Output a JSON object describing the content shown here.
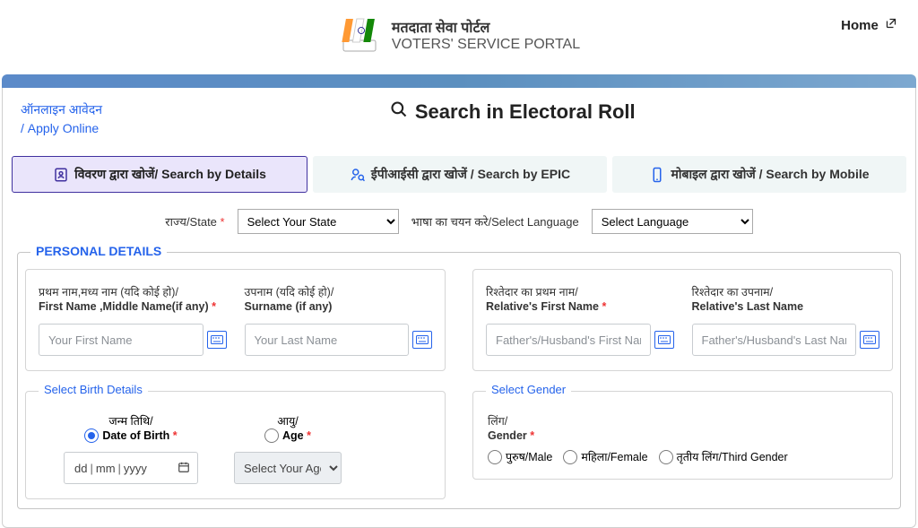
{
  "header": {
    "title_hi": "मतदाता सेवा पोर्टल",
    "title_en": "VOTERS' SERVICE PORTAL",
    "home": "Home"
  },
  "sidebar": {
    "apply_hi": "ऑनलाइन आवेदन",
    "apply_en": "/ Apply Online"
  },
  "main": {
    "title": "Search in Electoral Roll"
  },
  "tabs": {
    "details": "विवरण द्वारा खोजें/ Search by Details",
    "epic": "ईपीआईसी द्वारा खोजें / Search by EPIC",
    "mobile": "मोबाइल द्वारा खोजें / Search by Mobile"
  },
  "selects": {
    "state_lbl": "राज्य/State",
    "state_placeholder": "Select Your State",
    "lang_lbl": "भाषा का चयन करे/Select Language",
    "lang_placeholder": "Select Language"
  },
  "legend": "PERSONAL DETAILS",
  "name": {
    "first_hi": "प्रथम नाम,मध्य नाम (यदि कोई हो)/",
    "first_en": "First Name ,Middle Name(if any)",
    "first_ph": "Your First Name",
    "last_hi": "उपनाम (यदि कोई हो)/",
    "last_en": "Surname (if any)",
    "last_ph": "Your Last Name"
  },
  "rel": {
    "first_hi": "रिश्तेदार का प्रथम नाम/",
    "first_en": "Relative's First Name",
    "first_ph": "Father's/Husband's First Name",
    "last_hi": "रिश्तेदार का उपनाम/",
    "last_en": "Relative's Last Name",
    "last_ph": "Father's/Husband's Last Name"
  },
  "birth": {
    "legend": "Select Birth Details",
    "dob_hi": "जन्म तिथि/",
    "dob_en": "Date of Birth",
    "age_hi": "आयु/",
    "age_en": "Age",
    "dd": "dd",
    "mm": "mm",
    "yyyy": "yyyy",
    "age_ph": "Select Your Age"
  },
  "gender": {
    "legend": "Select Gender",
    "hi": "लिंग/",
    "en": "Gender",
    "male": "पुरुष/Male",
    "female": "महिला/Female",
    "third": "तृतीय लिंग/Third Gender"
  }
}
